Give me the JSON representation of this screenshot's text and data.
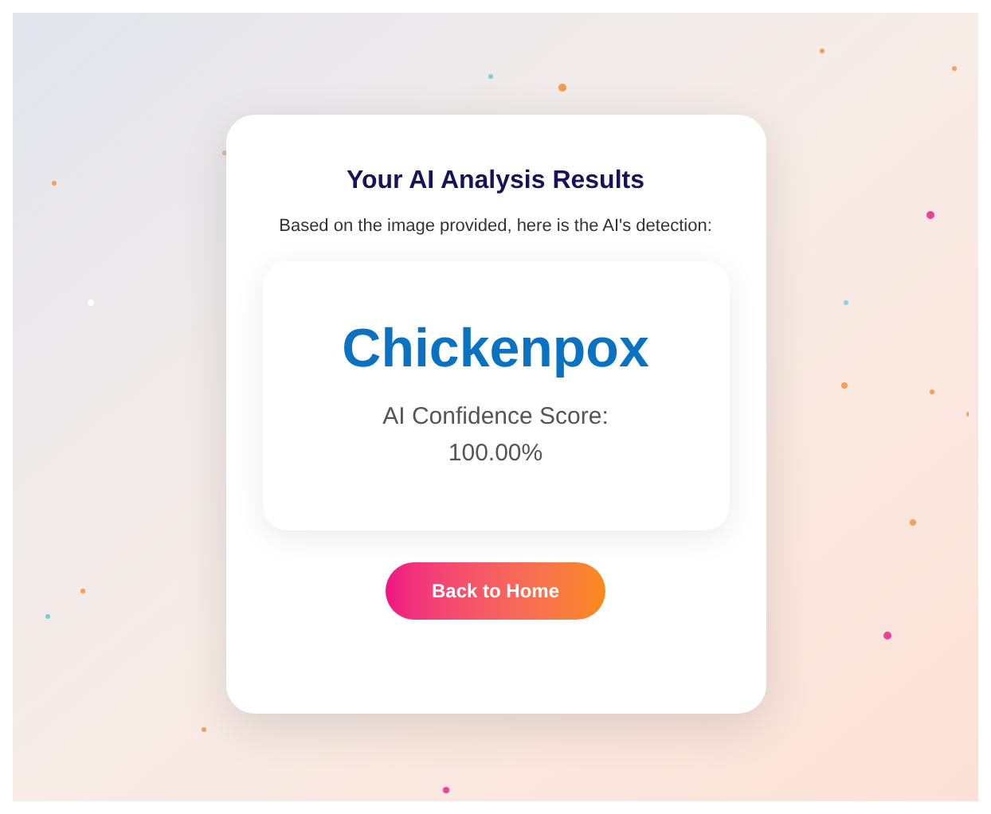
{
  "card": {
    "title": "Your AI Analysis Results",
    "subtitle": "Based on the image provided, here is the AI's detection:"
  },
  "result": {
    "diagnosis": "Chickenpox",
    "confidence_label": "AI Confidence Score:",
    "confidence_value": "100.00%"
  },
  "buttons": [
    {
      "label": "Back to Home"
    }
  ]
}
